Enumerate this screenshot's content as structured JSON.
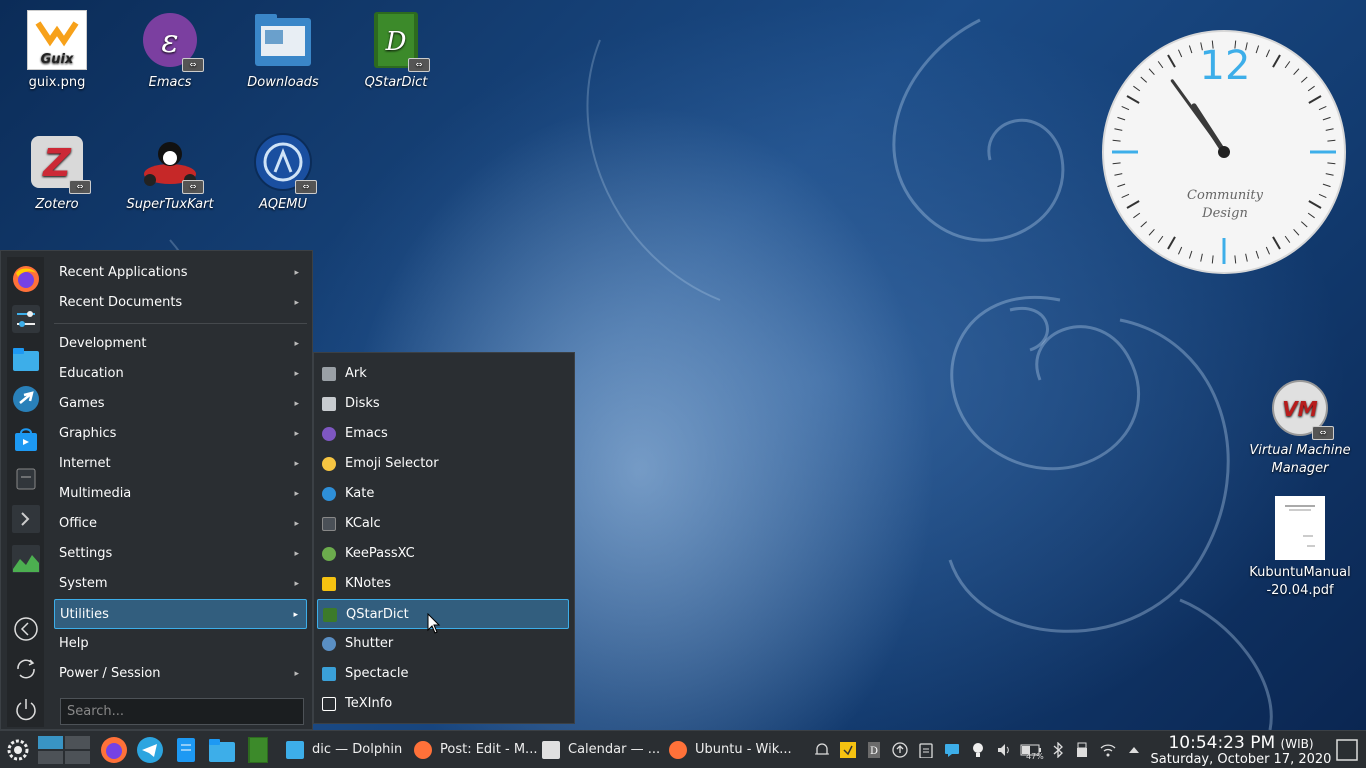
{
  "desktop": {
    "icons": [
      {
        "label": "guix.png",
        "icon": "guix-logo-icon",
        "badge": "Guix"
      },
      {
        "label": "Emacs",
        "icon": "emacs-icon"
      },
      {
        "label": "Downloads",
        "icon": "folder-icon"
      },
      {
        "label": "QStarDict",
        "icon": "qstardict-icon",
        "badge": "D"
      },
      {
        "label": "Zotero",
        "icon": "zotero-icon",
        "badge": "Z"
      },
      {
        "label": "SuperTuxKart",
        "icon": "supertuxkart-icon"
      },
      {
        "label": "AQEMU",
        "icon": "aqemu-icon"
      }
    ],
    "right_icons": [
      {
        "label_line1": "Virtual Machine",
        "label_line2": "Manager",
        "icon": "vm-manager-icon",
        "badge": "VM"
      },
      {
        "label_line1": "KubuntuManual",
        "label_line2": "-20.04.pdf",
        "icon": "pdf-icon"
      }
    ],
    "clock": {
      "number": "12",
      "text_line1": "Community",
      "text_line2": "Design",
      "hour": 10,
      "minute": 54
    }
  },
  "menu": {
    "top_items": [
      {
        "label": "Recent Applications",
        "has_submenu": true
      },
      {
        "label": "Recent Documents",
        "has_submenu": true
      }
    ],
    "items": [
      {
        "label": "Development",
        "has_submenu": true
      },
      {
        "label": "Education",
        "has_submenu": true
      },
      {
        "label": "Games",
        "has_submenu": true
      },
      {
        "label": "Graphics",
        "has_submenu": true
      },
      {
        "label": "Internet",
        "has_submenu": true
      },
      {
        "label": "Multimedia",
        "has_submenu": true
      },
      {
        "label": "Office",
        "has_submenu": true
      },
      {
        "label": "Settings",
        "has_submenu": true
      },
      {
        "label": "System",
        "has_submenu": true
      },
      {
        "label": "Utilities",
        "has_submenu": true,
        "selected": true
      },
      {
        "label": "Help",
        "has_submenu": false
      },
      {
        "label": "Power / Session",
        "has_submenu": true
      }
    ],
    "search_placeholder": "Search...",
    "favorites": [
      "firefox-icon",
      "settings-sliders-icon",
      "folder-icon",
      "kde-connect-icon",
      "discover-store-icon",
      "notes-icon",
      "terminal-icon",
      "system-monitor-icon"
    ],
    "session_buttons": [
      "back-icon",
      "refresh-icon",
      "power-icon"
    ],
    "arrow": "▸"
  },
  "submenu": {
    "items": [
      {
        "label": "Ark",
        "icon": "ark-icon",
        "color": "#9aa0a6"
      },
      {
        "label": "Disks",
        "icon": "disks-icon",
        "color": "#c8ccd0"
      },
      {
        "label": "Emacs",
        "icon": "emacs-icon",
        "color": "#7e57c2"
      },
      {
        "label": "Emoji Selector",
        "icon": "emoji-icon",
        "color": "#f6c542"
      },
      {
        "label": "Kate",
        "icon": "kate-icon",
        "color": "#2e8fd8"
      },
      {
        "label": "KCalc",
        "icon": "kcalc-icon",
        "color": "#4a5057"
      },
      {
        "label": "KeePassXC",
        "icon": "keepassxc-icon",
        "color": "#6cac4d"
      },
      {
        "label": "KNotes",
        "icon": "knotes-icon",
        "color": "#f5c211"
      },
      {
        "label": "QStarDict",
        "icon": "qstardict-icon",
        "color": "#3c7a2a",
        "selected": true
      },
      {
        "label": "Shutter",
        "icon": "shutter-icon",
        "color": "#5a8fc4"
      },
      {
        "label": "Spectacle",
        "icon": "spectacle-icon",
        "color": "#3aa0d8"
      },
      {
        "label": "TeXInfo",
        "icon": "texinfo-icon",
        "color": "#ffffff"
      }
    ]
  },
  "taskbar": {
    "launchers": [
      "kde-menu-icon",
      "pager-icon",
      "firefox-icon",
      "telegram-icon",
      "documents-icon",
      "dolphin-icon",
      "qstardict-icon"
    ],
    "tasks": [
      {
        "label": "dic — Dolphin",
        "icon": "dolphin-icon",
        "color": "#3daee9"
      },
      {
        "label": "Post: Edit - M...",
        "icon": "firefox-icon",
        "color": "#ff7139"
      },
      {
        "label": "Calendar — ...",
        "icon": "calendar-icon",
        "color": "#e0e0e0"
      },
      {
        "label": "Ubuntu - Wik...",
        "icon": "firefox-icon",
        "color": "#ff7139"
      }
    ],
    "tray": [
      "alarm-icon",
      "sticky-notes-icon",
      "dictionary-icon",
      "updates-icon",
      "clipboard-icon",
      "chat-icon",
      "bulb-icon",
      "volume-icon",
      "battery-icon",
      "bluetooth-icon",
      "usb-icon",
      "wifi-icon",
      "expand-tray-icon"
    ],
    "battery_percent": "47%",
    "time": "10:54:23 PM",
    "timezone": "(WIB)",
    "date": "Saturday, October 17, 2020",
    "show_desktop": "show-desktop-icon"
  }
}
